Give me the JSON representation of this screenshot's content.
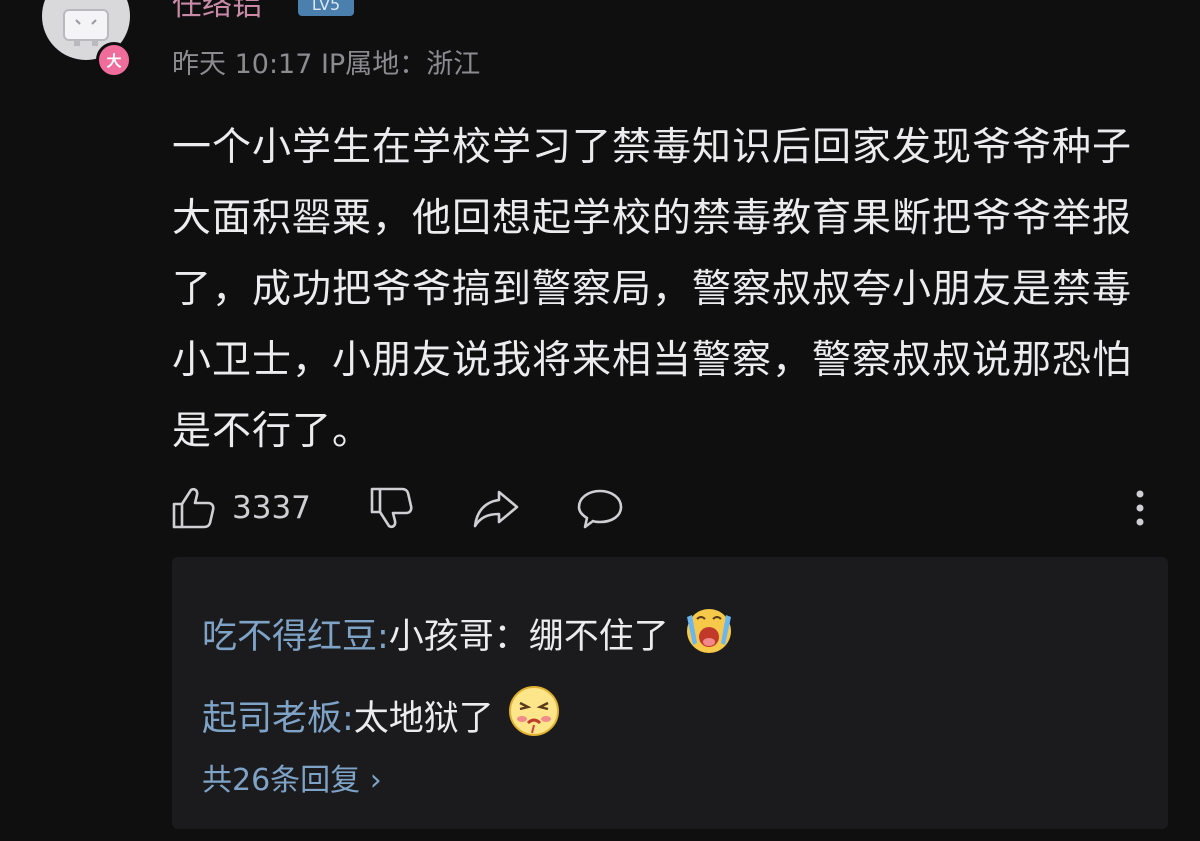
{
  "comment": {
    "username": "任络铝",
    "user_badge": "LV5",
    "level_dot": "大",
    "meta": "昨天 10:17 IP属地：浙江",
    "text": "一个小学生在学校学习了禁毒知识后回家发现爷爷种子大面积罂粟，他回想起学校的禁毒教育果断把爷爷举报了，成功把爷爷搞到警察局，警察叔叔夸小朋友是禁毒小卫士，小朋友说我将来相当警察，警察叔叔说那恐怕是不行了。",
    "like_count": "3337",
    "icons": [
      "thumbs-up-icon",
      "thumbs-down-icon",
      "share-icon",
      "comment-icon",
      "more-vertical-icon"
    ]
  },
  "replies": [
    {
      "author": "吃不得红豆:",
      "text": " 小孩哥：绷不住了",
      "emoji": "crying-emoji-icon"
    },
    {
      "author": "起司老板:",
      "text": " 太地狱了",
      "emoji": "blushing-emoji-icon"
    }
  ],
  "more_replies_label": "共26条回复 ›",
  "colors": {
    "background": "#0f0f10",
    "reply_background": "#1b1b1d",
    "link_blue": "#7ea3c7",
    "username_pink": "#c98aa6"
  }
}
